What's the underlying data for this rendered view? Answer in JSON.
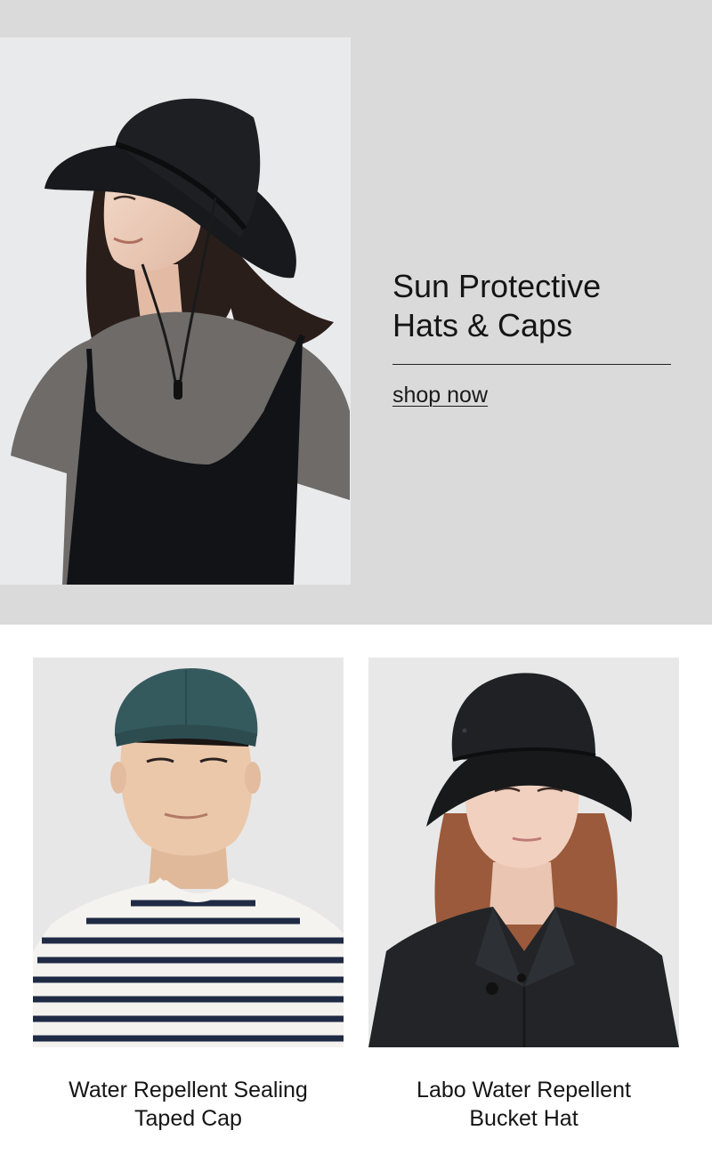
{
  "hero": {
    "title": "Sun Protective\nHats & Caps",
    "cta_label": "shop now",
    "image_alt": "Woman wearing a black wide-brim sun hat"
  },
  "products": [
    {
      "name": "Water Repellent Sealing\nTaped Cap",
      "image_alt": "Man wearing a teal taped cap and striped shirt"
    },
    {
      "name": "Labo Water Repellent\nBucket Hat",
      "image_alt": "Woman wearing a black bucket hat and black jacket"
    }
  ],
  "colors": {
    "hero_background": "#dadada",
    "page_background": "#ffffff",
    "text": "#151515",
    "cap_teal": "#355a5e",
    "hat_black": "#1b1d20"
  }
}
